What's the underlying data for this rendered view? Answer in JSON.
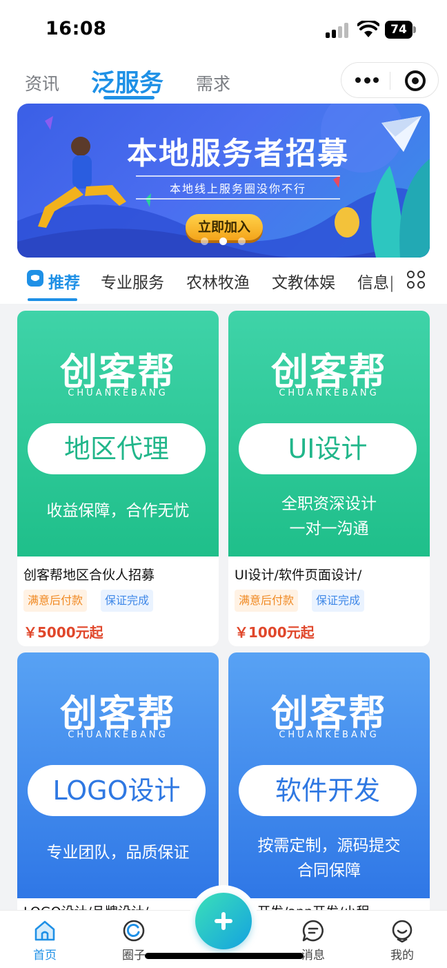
{
  "status_bar": {
    "time": "16:08",
    "battery": "74"
  },
  "top_nav": {
    "tabs": [
      {
        "label": "资讯",
        "active": false
      },
      {
        "label": "泛服务",
        "active": true
      },
      {
        "label": "需求",
        "active": false
      }
    ]
  },
  "banner": {
    "title": "本地服务者招募",
    "subtitle": "本地线上服务圈没你不行",
    "button": "立即加入",
    "active_dot": 2,
    "dot_count": 3
  },
  "categories": {
    "items": [
      {
        "label": "推荐",
        "active": true
      },
      {
        "label": "专业服务",
        "active": false
      },
      {
        "label": "农林牧渔",
        "active": false
      },
      {
        "label": "文教体娱",
        "active": false
      },
      {
        "label": "信息|",
        "active": false
      }
    ]
  },
  "products": [
    {
      "brand": "创客帮",
      "brand_en": "CHUANKEBANG",
      "pill": "地区代理",
      "slogan": [
        "收益保障，合作无忧"
      ],
      "theme": "green",
      "title": "创客帮地区合伙人招募",
      "tags": [
        "满意后付款",
        "保证完成"
      ],
      "price": "￥5000元起"
    },
    {
      "brand": "创客帮",
      "brand_en": "CHUANKEBANG",
      "pill": "UI设计",
      "slogan": [
        "全职资深设计",
        "一对一沟通"
      ],
      "theme": "green",
      "title": "UI设计/软件页面设计/",
      "tags": [
        "满意后付款",
        "保证完成"
      ],
      "price": "￥1000元起"
    },
    {
      "brand": "创客帮",
      "brand_en": "CHUANKEBANG",
      "pill": "LOGO设计",
      "slogan": [
        "专业团队，品质保证"
      ],
      "theme": "blue",
      "title_peek": "LOGO设计/品牌设计/"
    },
    {
      "brand": "创客帮",
      "brand_en": "CHUANKEBANG",
      "pill": "软件开发",
      "slogan": [
        "按需定制，源码提交",
        "合同保障"
      ],
      "theme": "blue",
      "title_peek": "开发/app开发/小程"
    }
  ],
  "tab_bar": {
    "items": [
      {
        "label": "首页",
        "icon": "home-icon",
        "active": true
      },
      {
        "label": "圈子",
        "icon": "circle-icon",
        "active": false
      },
      {
        "label": "消息",
        "icon": "message-icon",
        "active": false
      },
      {
        "label": "我的",
        "icon": "profile-icon",
        "active": false
      }
    ],
    "fab_icon": "plus-icon"
  },
  "colors": {
    "accent": "#1e90e6",
    "price": "#e0472b",
    "green_card": "#1fbf8a",
    "blue_card": "#2f77e6"
  }
}
